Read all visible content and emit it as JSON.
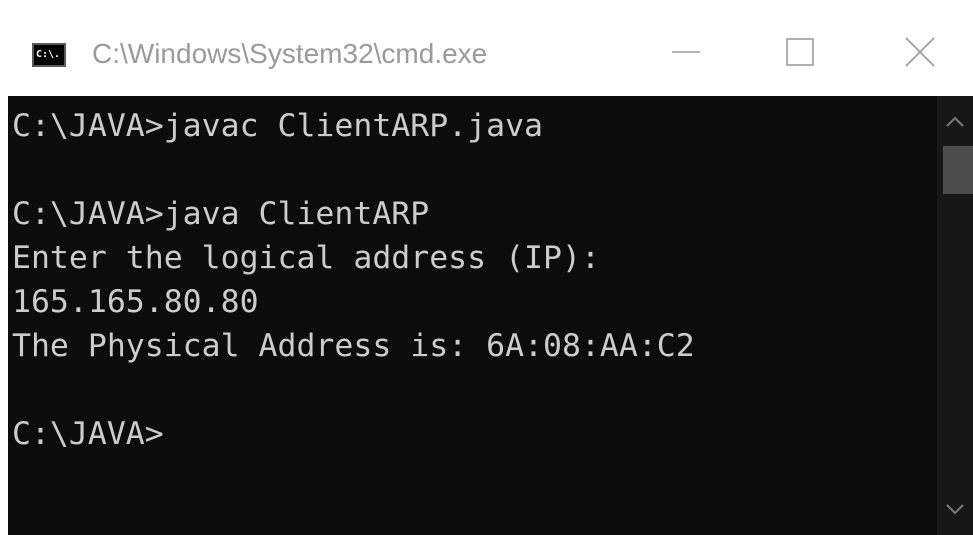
{
  "window": {
    "title": "C:\\Windows\\System32\\cmd.exe",
    "icon_text": "C:\\."
  },
  "controls": {
    "minimize_icon": "minimize-icon",
    "maximize_icon": "maximize-icon",
    "close_icon": "close-icon"
  },
  "terminal": {
    "lines": [
      "C:\\JAVA>javac ClientARP.java",
      "C:\\JAVA>java ClientARP",
      "Enter the logical address (IP):",
      "165.165.80.80",
      "The Physical Address is: 6A:08:AA:C2",
      "C:\\JAVA>"
    ]
  },
  "colors": {
    "terminal_bg": "#0c0c0c",
    "terminal_text": "#cccccc",
    "titlebar_bg": "#ffffff",
    "title_text": "#9a9a9a",
    "scrollbar_track": "#171717",
    "scrollbar_thumb": "#4d4d4d"
  }
}
